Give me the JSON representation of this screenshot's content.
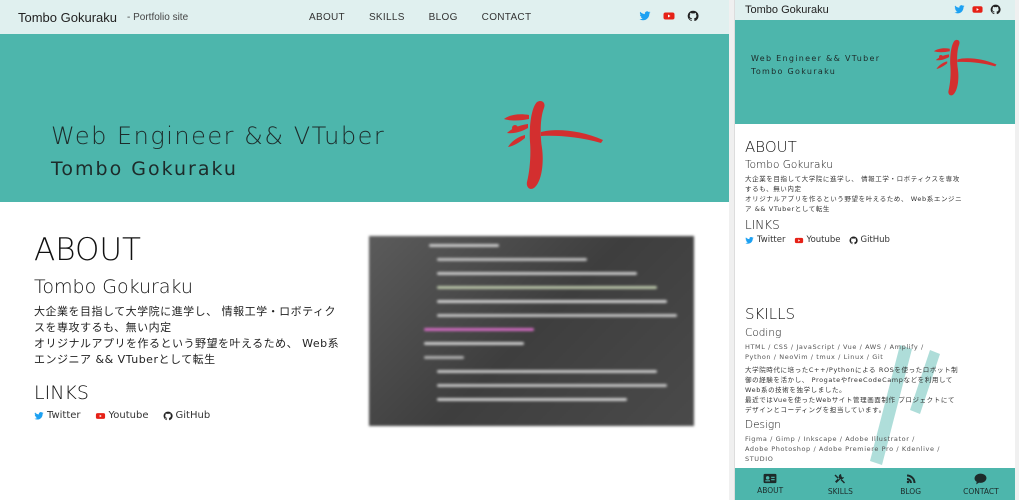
{
  "desktop": {
    "brand": "Tombo Gokuraku",
    "subtitle": "- Portfolio site",
    "menu": [
      "ABOUT",
      "SKILLS",
      "BLOG",
      "CONTACT"
    ],
    "hero": {
      "line1": "Web Engineer && VTuber",
      "line2": "Tombo Gokuraku"
    },
    "about": {
      "heading": "ABOUT",
      "name": "Tombo Gokuraku",
      "text": [
        "大企業を目指して大学院に進学し、 情報工学・ロボティク",
        "スを専攻するも、無い内定",
        "オリジナルアプリを作るという野望を叶えるため、 Web系",
        "エンジニア && VTuberとして転生"
      ],
      "links_heading": "LINKS",
      "links": [
        "Twitter",
        "Youtube",
        "GitHub"
      ]
    }
  },
  "mobile": {
    "brand": "Tombo Gokuraku",
    "hero": {
      "line1": "Web Engineer && VTuber",
      "line2": "Tombo Gokuraku"
    },
    "about": {
      "heading": "ABOUT",
      "name": "Tombo Gokuraku",
      "text": [
        "大企業を目指して大学院に進学し、 情報工学・ロボティクスを専攻",
        "するも、無い内定",
        "オリジナルアプリを作るという野望を叶えるため、 Web系エンジニ",
        "ア && VTuberとして転生"
      ],
      "links_heading": "LINKS",
      "links": [
        "Twitter",
        "Youtube",
        "GitHub"
      ]
    },
    "skills": {
      "heading": "SKILLS",
      "coding": {
        "heading": "Coding",
        "list": [
          "HTML / CSS / JavaScript / Vue / AWS / Amplify /",
          "Python / NeoVim / tmux / Linux / Git"
        ],
        "text": [
          "大学院時代に培ったC++/Pythonによる ROSを使ったロボット制",
          "御の経験を活かし、 ProgateやfreeCodeCampなどを利用して",
          "Web系の技術を独学しました。",
          "最近ではVueを使ったWebサイト管理画面制作 プロジェクトにて",
          "デザインとコーディングを担当しています。"
        ]
      },
      "design": {
        "heading": "Design",
        "list": [
          "Figma / Gimp / Inkscape / Adobe Illustrator /",
          "Adobe Photoshop / Adobe Premiere Pro / Kdenlive /",
          "STUDIO"
        ]
      }
    },
    "tabs": [
      "ABOUT",
      "SKILLS",
      "BLOG",
      "CONTACT"
    ]
  },
  "colors": {
    "teal": "#4db6ac",
    "nav_bg": "#e0f0ef",
    "dragonfly": "#d32f2f",
    "twitter": "#1da1f2",
    "youtube": "#e62117"
  },
  "icons": {
    "social": [
      "twitter-icon",
      "youtube-icon",
      "github-icon"
    ],
    "tabs": [
      "id-card-icon",
      "tools-icon",
      "blog-icon",
      "chat-icon"
    ]
  }
}
